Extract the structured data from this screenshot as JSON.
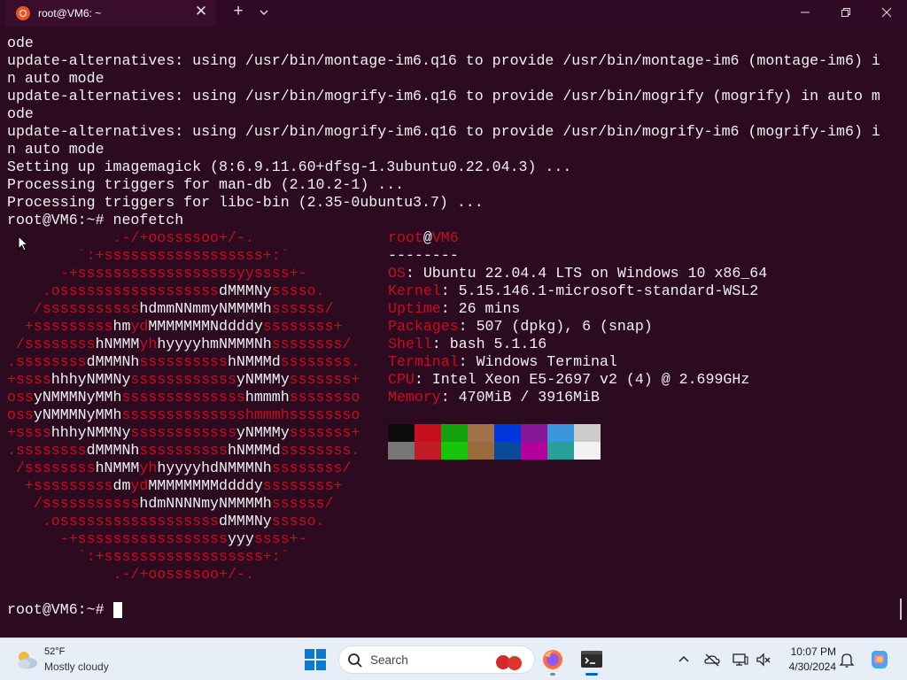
{
  "window": {
    "tab_title": "root@VM6: ~",
    "close_tab": "✕",
    "new_tab": "+",
    "minimize": "—",
    "maximize": "❐",
    "close": "✕"
  },
  "terminal": {
    "lines": [
      "ode",
      "update-alternatives: using /usr/bin/montage-im6.q16 to provide /usr/bin/montage-im6 (montage-im6) i",
      "n auto mode",
      "update-alternatives: using /usr/bin/mogrify-im6.q16 to provide /usr/bin/mogrify (mogrify) in auto m",
      "ode",
      "update-alternatives: using /usr/bin/mogrify-im6.q16 to provide /usr/bin/mogrify-im6 (mogrify-im6) i",
      "n auto mode",
      "Setting up imagemagick (8:6.9.11.60+dfsg-1.3ubuntu0.22.04.3) ...",
      "Processing triggers for man-db (2.10.2-1) ...",
      "Processing triggers for libc-bin (2.35-0ubuntu3.7) ...",
      "root@VM6:~# neofetch"
    ],
    "prompt": "root@VM6:~# ",
    "logo_lines": [
      [
        [
          "r",
          "            .-/+oossssoo+/-."
        ]
      ],
      [
        [
          "r",
          "        `:+ssssssssssssssssss+:`"
        ]
      ],
      [
        [
          "r",
          "      -+ssssssssssssssssssyyssss+-"
        ]
      ],
      [
        [
          "r",
          "    .ossssssssssssssssss"
        ],
        [
          "w",
          "dMMMNy"
        ],
        [
          "r",
          "sssso."
        ]
      ],
      [
        [
          "r",
          "   /sssssssssss"
        ],
        [
          "w",
          "hdmmNNmmyNMMMMh"
        ],
        [
          "r",
          "ssssss/"
        ]
      ],
      [
        [
          "r",
          "  +sssssssss"
        ],
        [
          "w",
          "hm"
        ],
        [
          "r",
          "yd"
        ],
        [
          "w",
          "MMMMMMMNddddy"
        ],
        [
          "r",
          "ssssssss+"
        ]
      ],
      [
        [
          "r",
          " /ssssssss"
        ],
        [
          "w",
          "hNMMM"
        ],
        [
          "r",
          "yh"
        ],
        [
          "w",
          "hyyyyhmNMMMNh"
        ],
        [
          "r",
          "ssssssss/"
        ]
      ],
      [
        [
          "r",
          ".ssssssss"
        ],
        [
          "w",
          "dMMMNh"
        ],
        [
          "r",
          "ssssssssss"
        ],
        [
          "w",
          "hNMMMd"
        ],
        [
          "r",
          "ssssssss."
        ]
      ],
      [
        [
          "r",
          "+ssss"
        ],
        [
          "w",
          "hhhyNMMNy"
        ],
        [
          "r",
          "ssssssssssss"
        ],
        [
          "w",
          "yNMMMy"
        ],
        [
          "r",
          "sssssss+"
        ]
      ],
      [
        [
          "r",
          "oss"
        ],
        [
          "w",
          "yNMMMNyMMh"
        ],
        [
          "r",
          "ssssssssssssss"
        ],
        [
          "w",
          "hmmmh"
        ],
        [
          "r",
          "ssssssso"
        ]
      ],
      [
        [
          "r",
          "oss"
        ],
        [
          "w",
          "yNMMMNyMMh"
        ],
        [
          "r",
          "sssssssssssssshmmmhssssssso"
        ]
      ],
      [
        [
          "r",
          "+ssss"
        ],
        [
          "w",
          "hhhyNMMNy"
        ],
        [
          "r",
          "ssssssssssss"
        ],
        [
          "w",
          "yNMMMy"
        ],
        [
          "r",
          "sssssss+"
        ]
      ],
      [
        [
          "r",
          ".ssssssss"
        ],
        [
          "w",
          "dMMMNh"
        ],
        [
          "r",
          "ssssssssss"
        ],
        [
          "w",
          "hNMMMd"
        ],
        [
          "r",
          "ssssssss."
        ]
      ],
      [
        [
          "r",
          " /ssssssss"
        ],
        [
          "w",
          "hNMMM"
        ],
        [
          "r",
          "yh"
        ],
        [
          "w",
          "hyyyyhdNMMMNh"
        ],
        [
          "r",
          "ssssssss/"
        ]
      ],
      [
        [
          "r",
          "  +sssssssss"
        ],
        [
          "w",
          "dm"
        ],
        [
          "r",
          "yd"
        ],
        [
          "w",
          "MMMMMMMMddddy"
        ],
        [
          "r",
          "ssssssss+"
        ]
      ],
      [
        [
          "r",
          "   /sssssssssss"
        ],
        [
          "w",
          "hdmNNNNmyNMMMMh"
        ],
        [
          "r",
          "ssssss/"
        ]
      ],
      [
        [
          "r",
          "    .ossssssssssssssssss"
        ],
        [
          "w",
          "dMMMNy"
        ],
        [
          "r",
          "sssso."
        ]
      ],
      [
        [
          "r",
          "      -+sssssssssssssssss"
        ],
        [
          "w",
          "yyy"
        ],
        [
          "r",
          "ssss+-"
        ]
      ],
      [
        [
          "r",
          "        `:+ssssssssssssssssss+:`"
        ]
      ],
      [
        [
          "r",
          "            .-/+oossssoo+/-."
        ]
      ]
    ],
    "info": {
      "user": "root",
      "at": "@",
      "host": "VM6",
      "separator": "--------",
      "fields": [
        {
          "label": "OS",
          "value": "Ubuntu 22.04.4 LTS on Windows 10 x86_64"
        },
        {
          "label": "Kernel",
          "value": "5.15.146.1-microsoft-standard-WSL2"
        },
        {
          "label": "Uptime",
          "value": "26 mins"
        },
        {
          "label": "Packages",
          "value": "507 (dpkg), 6 (snap)"
        },
        {
          "label": "Shell",
          "value": "bash 5.1.16"
        },
        {
          "label": "Terminal",
          "value": "Windows Terminal"
        },
        {
          "label": "CPU",
          "value": "Intel Xeon E5-2697 v2 (4) @ 2.699GHz"
        },
        {
          "label": "Memory",
          "value": "470MiB / 3916MiB"
        }
      ]
    },
    "palette_top": [
      "#0c0c0c",
      "#c50f1f",
      "#13a10e",
      "#a0714a",
      "#0037da",
      "#881798",
      "#3a96dd",
      "#cccccc"
    ],
    "palette_bottom": [
      "#767676",
      "#c01c28",
      "#16c60c",
      "#9b6a3c",
      "#0a4a9a",
      "#b4009e",
      "#2aa198",
      "#f2f2f2"
    ]
  },
  "taskbar": {
    "weather_temp": "52°F",
    "weather_condition": "Mostly cloudy",
    "search_placeholder": "Search",
    "time": "10:07 PM",
    "date": "4/30/2024"
  }
}
